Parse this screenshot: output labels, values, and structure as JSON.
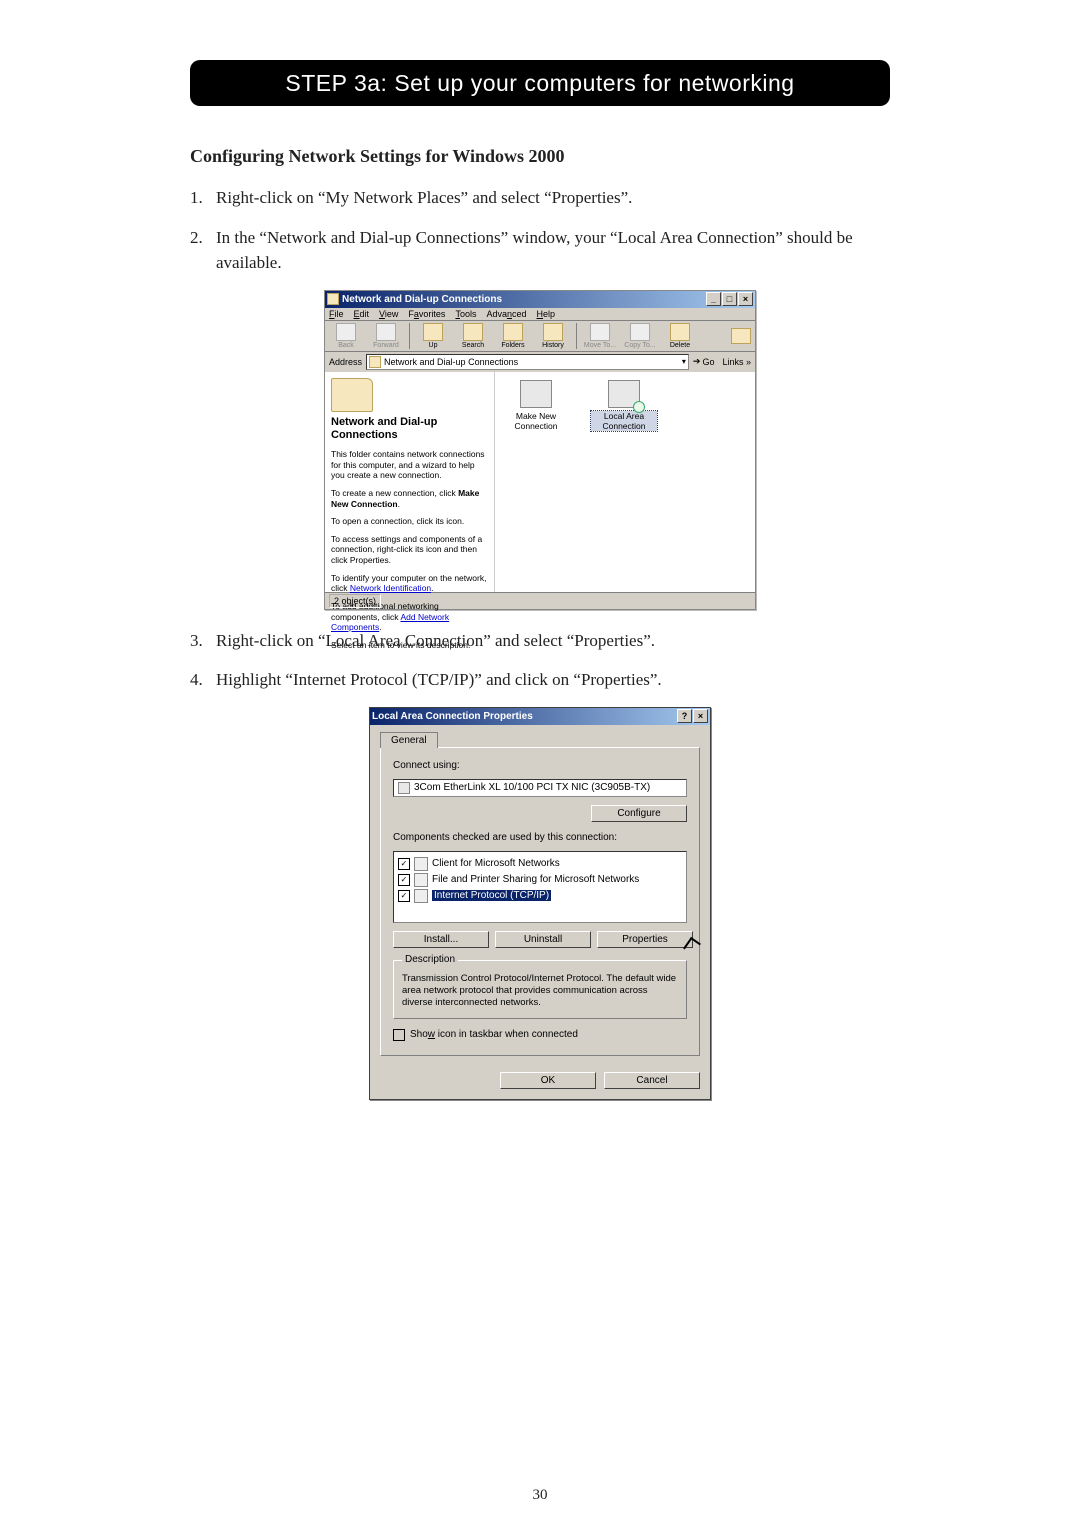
{
  "banner": "STEP 3a: Set up your computers for networking",
  "section_title": "Configuring Network Settings for Windows 2000",
  "steps": {
    "1": "Right-click on “My Network Places” and select “Properties”.",
    "2": "In the “Network and Dial-up Connections” window, your “Local Area Connection” should be available.",
    "3": "Right-click on “Local Area Connection” and select “Properties”.",
    "4": "Highlight “Internet Protocol (TCP/IP)” and click on “Properties”."
  },
  "win1": {
    "title": "Network and Dial-up Connections",
    "menu": {
      "file": "File",
      "edit": "Edit",
      "view": "View",
      "fav": "Favorites",
      "tools": "Tools",
      "adv": "Advanced",
      "help": "Help"
    },
    "toolbar": {
      "back": "Back",
      "forward": "Forward",
      "up": "Up",
      "search": "Search",
      "folders": "Folders",
      "history": "History",
      "moveto": "Move To...",
      "copyto": "Copy To...",
      "delete": "Delete"
    },
    "address_label": "Address",
    "address_value": "Network and Dial-up Connections",
    "go": "Go",
    "links": "Links »",
    "side": {
      "heading": "Network and Dial-up Connections",
      "p1": "This folder contains network connections for this computer, and a wizard to help you create a new connection.",
      "p2_a": "To create a new connection, click ",
      "p2_b": "Make New Connection",
      "p3": "To open a connection, click its icon.",
      "p4": "To access settings and components of a connection, right-click its icon and then click Properties.",
      "p5_a": "To identify your computer on the network, click ",
      "p5_link": "Network Identification",
      "p6_a": "To add additional networking components, click ",
      "p6_link": "Add Network Components",
      "p7": "Select an item to view its description."
    },
    "icons": {
      "makenew": "Make New Connection",
      "lac": "Local Area Connection"
    },
    "status": "2 object(s)"
  },
  "dlg": {
    "title": "Local Area Connection Properties",
    "tab": "General",
    "connect_using": "Connect using:",
    "adapter": "3Com EtherLink XL 10/100 PCI TX NIC (3C905B-TX)",
    "configure": "Configure",
    "components_label": "Components checked are used by this connection:",
    "items": {
      "0": "Client for Microsoft Networks",
      "1": "File and Printer Sharing for Microsoft Networks",
      "2": "Internet Protocol (TCP/IP)"
    },
    "install": "Install...",
    "uninstall": "Uninstall",
    "properties": "Properties",
    "desc_legend": "Description",
    "desc_text": "Transmission Control Protocol/Internet Protocol. The default wide area network protocol that provides communication across diverse interconnected networks.",
    "show_icon": "Show icon in taskbar when connected",
    "ok": "OK",
    "cancel": "Cancel"
  },
  "page_number": "30"
}
